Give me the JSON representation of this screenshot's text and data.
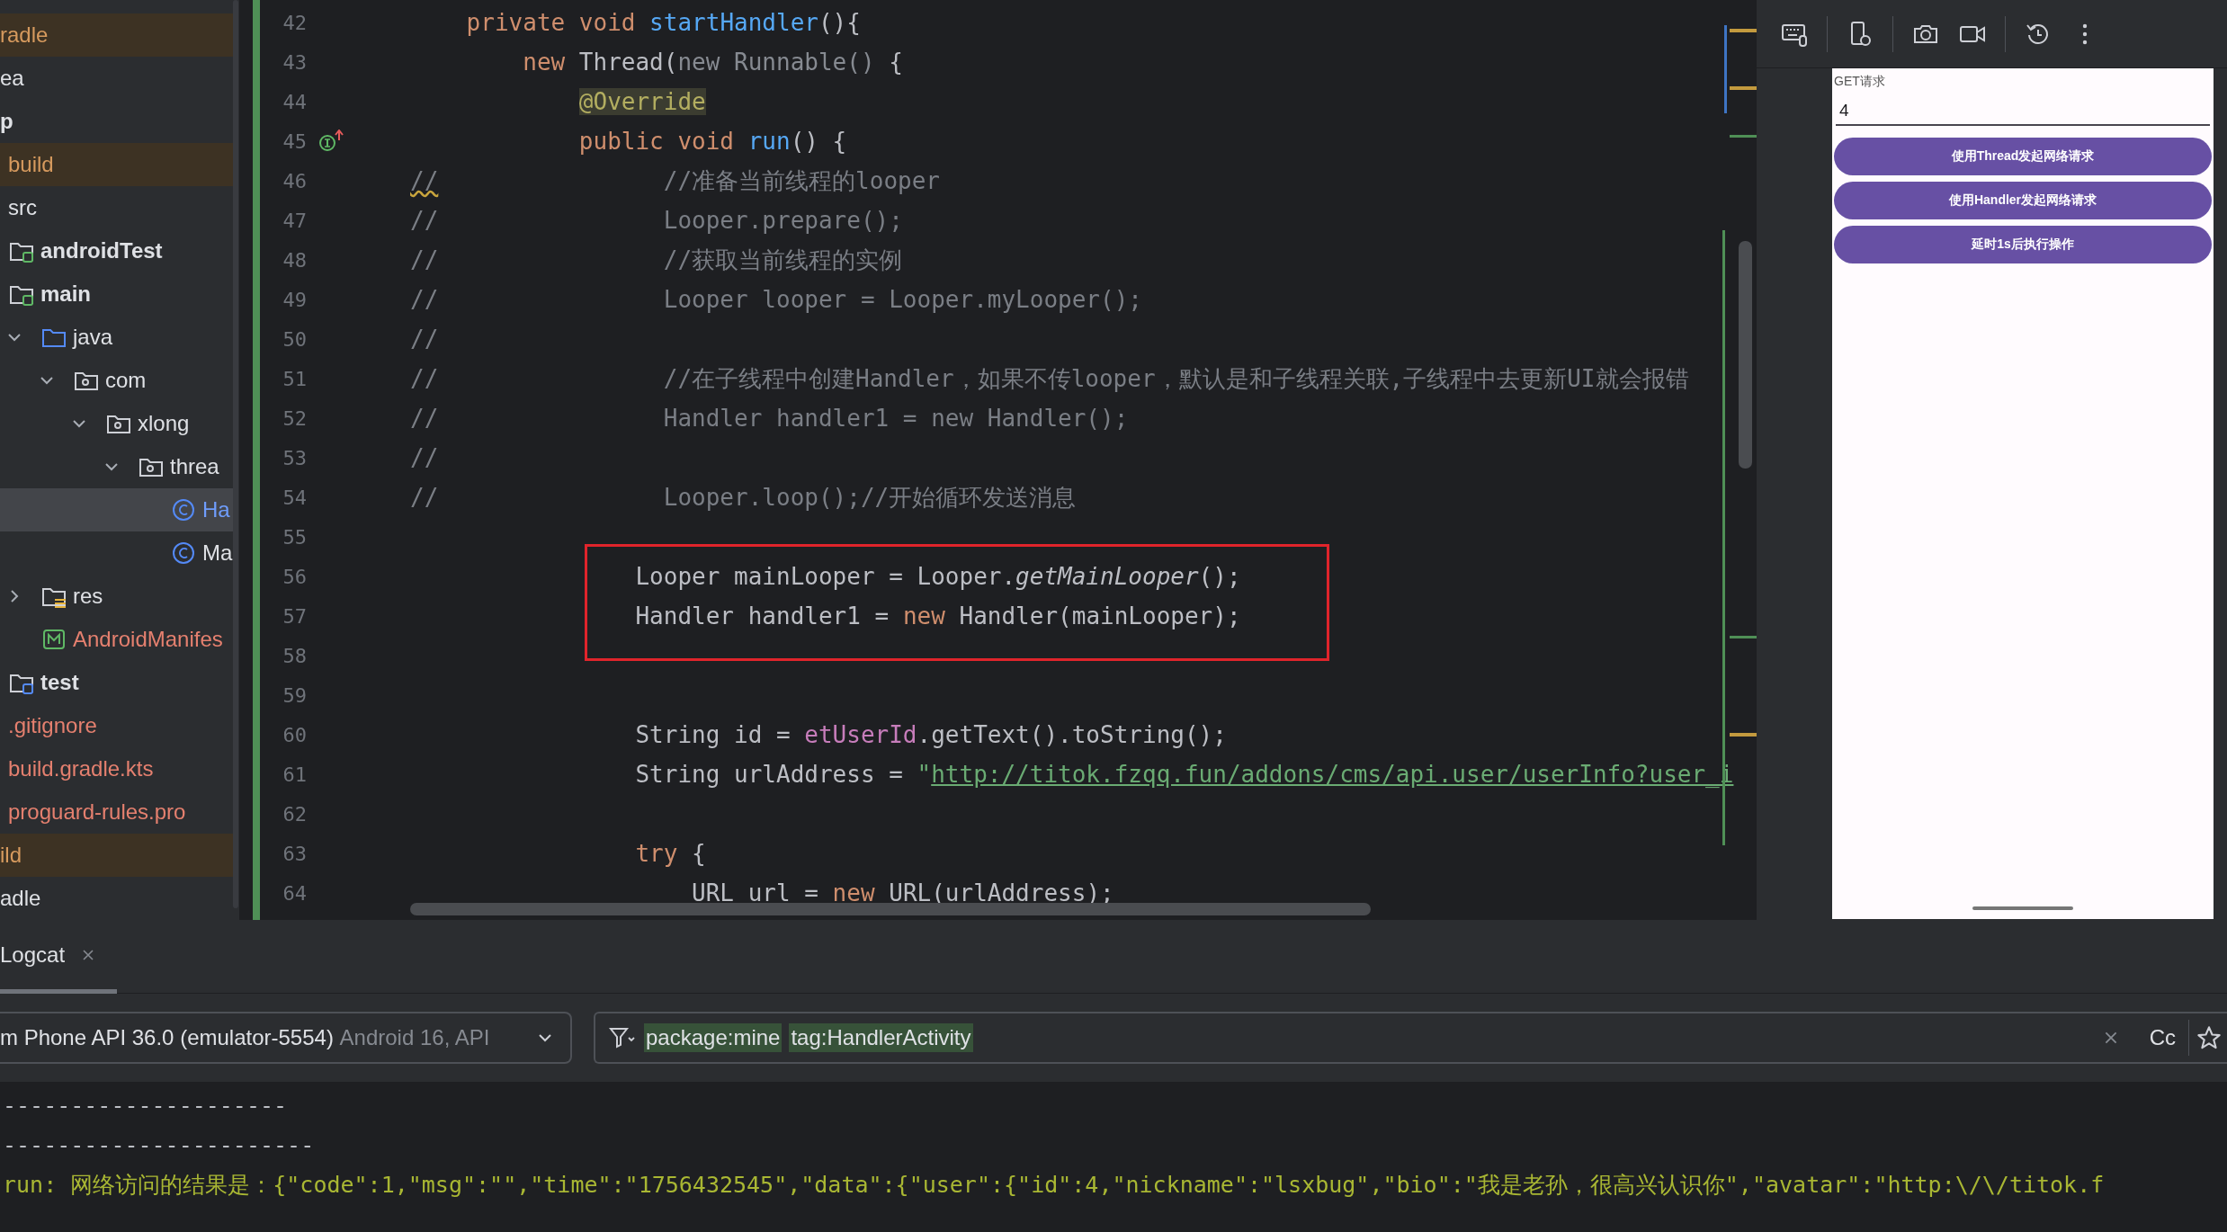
{
  "project_tree": [
    {
      "label": "radle",
      "color": "#d69a5e",
      "excluded": true,
      "selected": false
    },
    {
      "label": "ea",
      "color": "#dfe1e5",
      "excluded": false,
      "selected": false
    },
    {
      "label": "p",
      "kind": "module",
      "color": "#dfe1e5",
      "excluded": false,
      "selected": false,
      "children": [
        {
          "label": "build",
          "color": "#d69a5e",
          "excluded": true,
          "selected": false
        },
        {
          "label": "src",
          "color": "#dfe1e5",
          "excluded": false,
          "selected": false,
          "children": [
            {
              "label": "androidTest",
              "kind": "source_root",
              "color": "#dfe1e5",
              "excluded": false,
              "selected": false
            },
            {
              "label": "main",
              "kind": "source_root",
              "color": "#dfe1e5",
              "excluded": false,
              "selected": false,
              "children": [
                {
                  "label": "java",
                  "kind": "java_root",
                  "color": "#dfe1e5",
                  "excluded": false,
                  "selected": false,
                  "expanded": true,
                  "children": [
                    {
                      "label": "com",
                      "kind": "package",
                      "color": "#dfe1e5",
                      "excluded": false,
                      "selected": false,
                      "expanded": true,
                      "children": [
                        {
                          "label": "xlong",
                          "kind": "package",
                          "color": "#dfe1e5",
                          "excluded": false,
                          "selected": false,
                          "expanded": true,
                          "children": [
                            {
                              "label": "threa",
                              "kind": "package",
                              "color": "#dfe1e5",
                              "excluded": false,
                              "selected": false,
                              "expanded": true,
                              "children": [
                                {
                                  "label": "Ha",
                                  "kind": "class",
                                  "color": "#6f9dfc",
                                  "excluded": false,
                                  "selected": true
                                },
                                {
                                  "label": "Ma",
                                  "kind": "class",
                                  "color": "#dfe1e5",
                                  "excluded": false,
                                  "selected": false
                                }
                              ]
                            }
                          ]
                        }
                      ]
                    }
                  ]
                },
                {
                  "label": "res",
                  "kind": "resource_root",
                  "color": "#dfe1e5",
                  "excluded": false,
                  "selected": false,
                  "expanded": false
                },
                {
                  "label": "AndroidManifes",
                  "kind": "manifest",
                  "color": "#e5806f",
                  "excluded": false,
                  "selected": false
                }
              ]
            },
            {
              "label": "test",
              "kind": "test_root",
              "color": "#dfe1e5",
              "excluded": false,
              "selected": false
            }
          ]
        },
        {
          "label": ".gitignore",
          "color": "#e5806f",
          "excluded": false,
          "selected": false
        },
        {
          "label": "build.gradle.kts",
          "color": "#e5806f",
          "excluded": false,
          "selected": false
        },
        {
          "label": "proguard-rules.pro",
          "color": "#e5806f",
          "excluded": false,
          "selected": false
        }
      ]
    },
    {
      "label": "ild",
      "color": "#d69a5e",
      "excluded": true,
      "selected": false
    },
    {
      "label": "adle",
      "color": "#dfe1e5",
      "excluded": false,
      "selected": false
    }
  ],
  "editor": {
    "lines": [
      {
        "number": "42",
        "tokens": [
          {
            "text": "    private void ",
            "kind": "keyword"
          },
          {
            "text": "startHandler",
            "kind": "function"
          },
          {
            "text": "(){",
            "kind": "plain"
          }
        ]
      },
      {
        "number": "43",
        "tokens": [
          {
            "text": "        new ",
            "kind": "keyword"
          },
          {
            "text": "Thread(",
            "kind": "plain"
          },
          {
            "text": "new Runnable() ",
            "kind": "dim"
          },
          {
            "text": "{",
            "kind": "plain"
          }
        ]
      },
      {
        "number": "44",
        "tokens": [
          {
            "text": "            @Override",
            "kind": "annotation"
          }
        ]
      },
      {
        "number": "45",
        "gutter": {
          "kind": "implements"
        },
        "tokens": [
          {
            "text": "            public void ",
            "kind": "keyword"
          },
          {
            "text": "run",
            "kind": "function"
          },
          {
            "text": "() {",
            "kind": "plain"
          }
        ]
      },
      {
        "number": "46",
        "tokens": [
          {
            "text": "//",
            "kind": "warning"
          },
          {
            "text": "                //准备当前线程的looper",
            "kind": "comment"
          }
        ]
      },
      {
        "number": "47",
        "tokens": [
          {
            "text": "//                Looper.prepare();",
            "kind": "comment"
          }
        ]
      },
      {
        "number": "48",
        "tokens": [
          {
            "text": "//                //获取当前线程的实例",
            "kind": "comment"
          }
        ]
      },
      {
        "number": "49",
        "tokens": [
          {
            "text": "//                Looper looper = Looper.myLooper();",
            "kind": "comment"
          }
        ]
      },
      {
        "number": "50",
        "tokens": [
          {
            "text": "//",
            "kind": "comment"
          }
        ]
      },
      {
        "number": "51",
        "tokens": [
          {
            "text": "//                //在子线程中创建Handler，如果不传looper，默认是和子线程关联,子线程中去更新UI就会报错",
            "kind": "comment"
          }
        ]
      },
      {
        "number": "52",
        "tokens": [
          {
            "text": "//                Handler handler1 = new Handler();",
            "kind": "comment"
          }
        ]
      },
      {
        "number": "53",
        "tokens": [
          {
            "text": "//",
            "kind": "comment"
          }
        ]
      },
      {
        "number": "54",
        "tokens": [
          {
            "text": "//                Looper.loop();//开始循环发送消息",
            "kind": "comment"
          }
        ]
      },
      {
        "number": "55"
      },
      {
        "number": "56",
        "tokens": [
          {
            "text": "                Looper mainLooper = Looper.",
            "kind": "plain"
          },
          {
            "text": "getMainLooper",
            "kind": "italic"
          },
          {
            "text": "();",
            "kind": "plain"
          }
        ]
      },
      {
        "number": "57",
        "tokens": [
          {
            "text": "                Handler handler1 = ",
            "kind": "plain"
          },
          {
            "text": "new ",
            "kind": "keyword"
          },
          {
            "text": "Handler(mainLooper);",
            "kind": "plain"
          }
        ]
      },
      {
        "number": "58"
      },
      {
        "number": "59"
      },
      {
        "number": "60",
        "tokens": [
          {
            "text": "                String id = ",
            "kind": "plain"
          },
          {
            "text": "etUserId",
            "kind": "field"
          },
          {
            "text": ".getText().toString();",
            "kind": "plain"
          }
        ]
      },
      {
        "number": "61",
        "tokens": [
          {
            "text": "                String urlAddress = ",
            "kind": "plain"
          },
          {
            "text": "\"",
            "kind": "string"
          },
          {
            "text": "http://titok.fzqq.fun/addons/cms/api.user/userInfo?user_i",
            "kind": "link"
          }
        ]
      },
      {
        "number": "62"
      },
      {
        "number": "63",
        "tokens": [
          {
            "text": "                try ",
            "kind": "keyword"
          },
          {
            "text": "{",
            "kind": "plain"
          }
        ]
      },
      {
        "number": "64",
        "tokens": [
          {
            "text": "                    URL url = ",
            "kind": "plain"
          },
          {
            "text": "new ",
            "kind": "keyword"
          },
          {
            "text": "URL(urlAddress);",
            "kind": "plain"
          }
        ]
      }
    ]
  },
  "app_screen": {
    "title": "GET请求",
    "input_value": "4",
    "buttons": [
      "使用Thread发起网络请求",
      "使用Handler发起网络请求",
      "延时1s后执行操作"
    ]
  },
  "logcat": {
    "tabs": [
      {
        "label": "Logcat",
        "selected": true
      }
    ],
    "device": {
      "name": "m Phone API 36.0 (emulator-5554)",
      "detail": "Android 16, API"
    },
    "filter_tokens": [
      "package:mine",
      "tag:HandlerActivity"
    ],
    "case_toggle": "Cc",
    "lines": [
      {
        "text": "---------------------",
        "kind": "separator"
      },
      {
        "text": "-----------------------",
        "kind": "separator"
      },
      {
        "text": "run: 网络访问的结果是：{\"code\":1,\"msg\":\"\",\"time\":\"1756432545\",\"data\":{\"user\":{\"id\":4,\"nickname\":\"lsxbug\",\"bio\":\"我是老孙，很高兴认识你\",\"avatar\":\"http:\\/\\/titok.f",
        "kind": "info"
      }
    ]
  }
}
